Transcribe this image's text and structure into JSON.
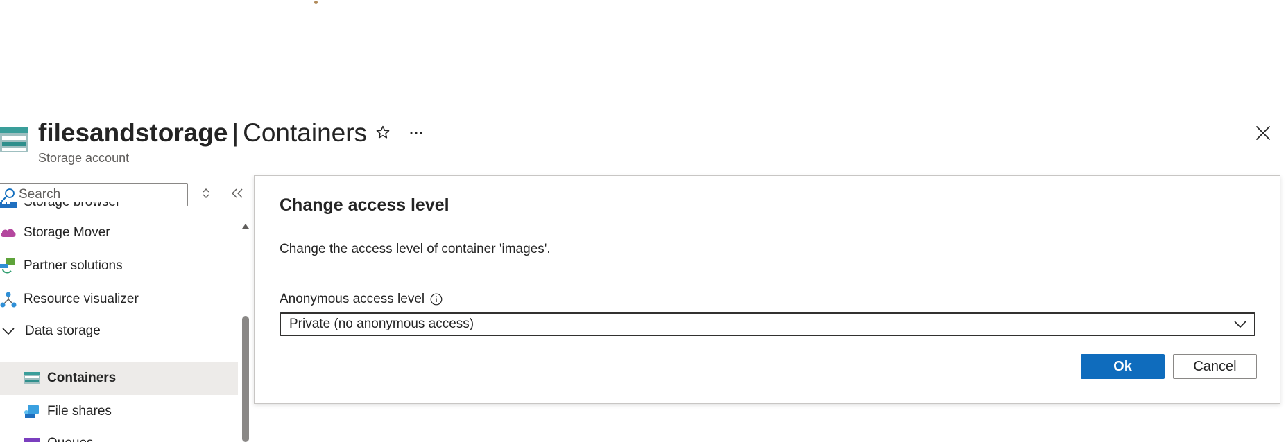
{
  "header": {
    "resource_name": "filesandstorage",
    "separator": "|",
    "section": "Containers",
    "subtitle": "Storage account",
    "icons": {
      "resource": "storage-account-icon",
      "favorite": "star-icon",
      "more": "more-options-icon",
      "close": "close-icon"
    }
  },
  "sidebar": {
    "search": {
      "placeholder": "Search",
      "value": ""
    },
    "items": [
      {
        "label": "Storage browser",
        "icon": "storage-browser-icon",
        "level": 0
      },
      {
        "label": "Storage Mover",
        "icon": "storage-mover-icon",
        "level": 0
      },
      {
        "label": "Partner solutions",
        "icon": "partner-solutions-icon",
        "level": 0
      },
      {
        "label": "Resource visualizer",
        "icon": "resource-visualizer-icon",
        "level": 0
      },
      {
        "label": "Data storage",
        "icon": "chevron-down-icon",
        "level": 0,
        "expanded": true
      },
      {
        "label": "Containers",
        "icon": "containers-icon",
        "level": 1,
        "selected": true
      },
      {
        "label": "File shares",
        "icon": "file-shares-icon",
        "level": 1
      },
      {
        "label": "Queues",
        "icon": "queues-icon",
        "level": 1
      }
    ]
  },
  "dialog": {
    "title": "Change access level",
    "description": "Change the access level of container 'images'.",
    "field_label": "Anonymous access level",
    "selected_value": "Private (no anonymous access)",
    "ok_label": "Ok",
    "cancel_label": "Cancel"
  },
  "colors": {
    "accent": "#0f6cbd",
    "selected_bg": "#edebe9",
    "border": "#8a8886"
  }
}
